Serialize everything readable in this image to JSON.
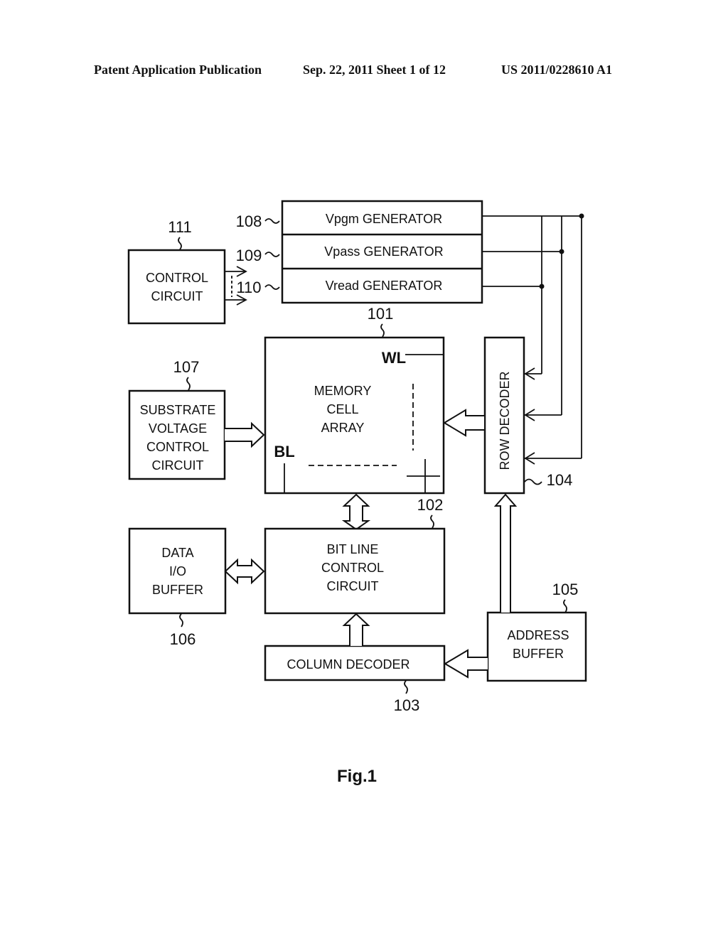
{
  "header": {
    "publication": "Patent Application Publication",
    "date_sheet": "Sep. 22, 2011   Sheet 1 of 12",
    "number": "US 2011/0228610 A1"
  },
  "blocks": {
    "vpgm": {
      "ref": "108",
      "label": "Vpgm GENERATOR"
    },
    "vpass": {
      "ref": "109",
      "label": "Vpass GENERATOR"
    },
    "vread": {
      "ref": "110",
      "label": "Vread GENERATOR"
    },
    "control": {
      "ref": "111",
      "lines": [
        "CONTROL",
        "CIRCUIT"
      ]
    },
    "memory": {
      "ref": "101",
      "lines": [
        "MEMORY",
        "CELL",
        "ARRAY"
      ],
      "wl": "WL",
      "bl": "BL"
    },
    "substrate": {
      "ref": "107",
      "lines": [
        "SUBSTRATE",
        "VOLTAGE",
        "CONTROL",
        "CIRCUIT"
      ]
    },
    "row_decoder": {
      "ref": "104",
      "label": "ROW DECODER"
    },
    "bitline": {
      "ref": "102",
      "lines": [
        "BIT LINE",
        "CONTROL",
        "CIRCUIT"
      ]
    },
    "data_io": {
      "ref": "106",
      "lines": [
        "DATA",
        "I/O",
        "BUFFER"
      ]
    },
    "column_decoder": {
      "ref": "103",
      "label": "COLUMN DECODER"
    },
    "address": {
      "ref": "105",
      "lines": [
        "ADDRESS",
        "BUFFER"
      ]
    }
  },
  "figure_label": "Fig.1"
}
